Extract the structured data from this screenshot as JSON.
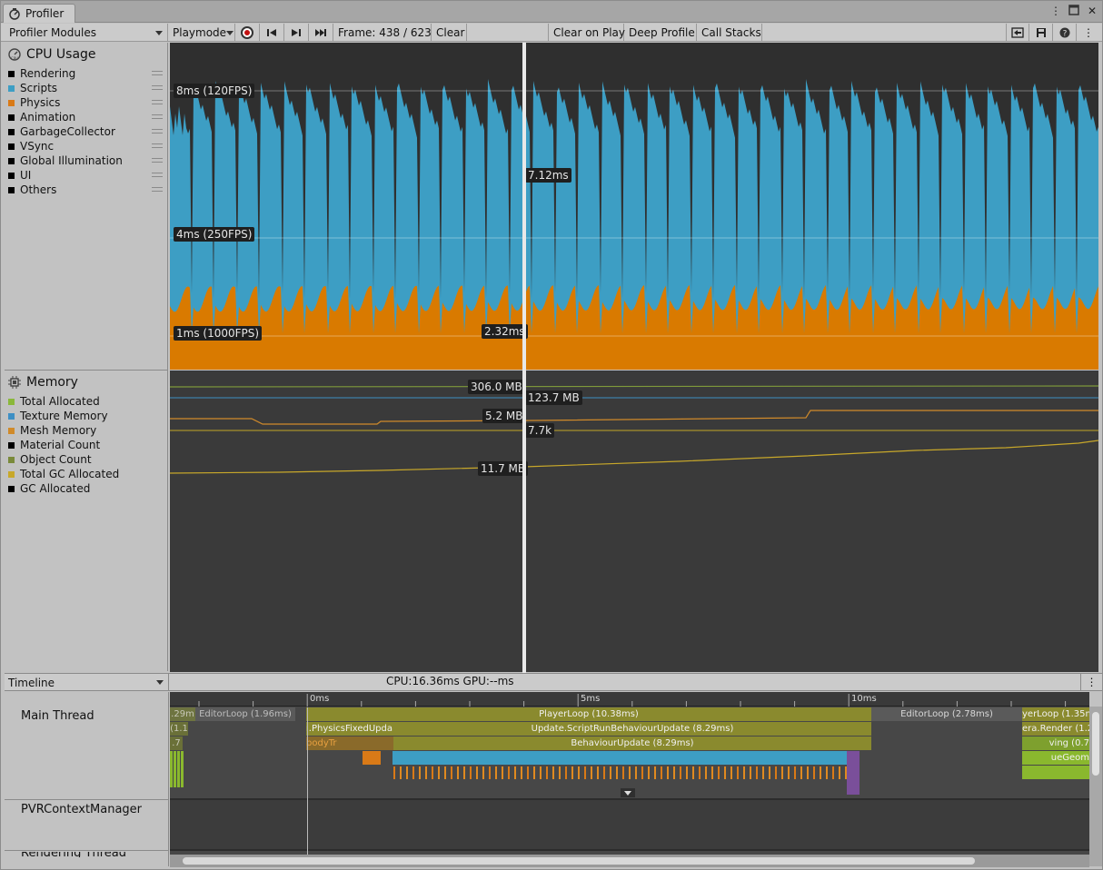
{
  "window": {
    "tab_title": "Profiler",
    "menu_icon": "kebab-icon",
    "max_icon": "maximize-icon",
    "close_label": "✕"
  },
  "toolbar": {
    "modules_label": "Profiler Modules",
    "target_label": "Playmode",
    "frame_label": "Frame: 438 / 623",
    "clear_label": "Clear",
    "clear_on_play_label": "Clear on Play",
    "deep_profile_label": "Deep Profile",
    "call_stacks_label": "Call Stacks"
  },
  "cpu_module": {
    "title": "CPU Usage",
    "legend": [
      {
        "label": "Rendering",
        "color": "#000000"
      },
      {
        "label": "Scripts",
        "color": "#3d9ec4"
      },
      {
        "label": "Physics",
        "color": "#d97a17"
      },
      {
        "label": "Animation",
        "color": "#000000"
      },
      {
        "label": "GarbageCollector",
        "color": "#000000"
      },
      {
        "label": "VSync",
        "color": "#000000"
      },
      {
        "label": "Global Illumination",
        "color": "#000000"
      },
      {
        "label": "UI",
        "color": "#000000"
      },
      {
        "label": "Others",
        "color": "#000000"
      }
    ],
    "labels": {
      "line_8ms": "8ms (120FPS)",
      "line_4ms": "4ms (250FPS)",
      "line_1ms": "1ms (1000FPS)",
      "scripts_value": "7.12ms",
      "physics_value": "2.32ms"
    }
  },
  "memory_module": {
    "title": "Memory",
    "legend": [
      {
        "label": "Total Allocated",
        "color": "#8ab83a"
      },
      {
        "label": "Texture Memory",
        "color": "#3d8fc4"
      },
      {
        "label": "Mesh Memory",
        "color": "#d08a2a"
      },
      {
        "label": "Material Count",
        "color": "#000000"
      },
      {
        "label": "Object Count",
        "color": "#7a8a3a"
      },
      {
        "label": "Total GC Allocated",
        "color": "#c8a82a"
      },
      {
        "label": "GC Allocated",
        "color": "#000000"
      }
    ],
    "labels": {
      "total_allocated": "306.0 MB",
      "texture_memory": "123.7 MB",
      "mesh_memory": "5.2 MB",
      "object_count": "7.7k",
      "total_gc": "11.7 MB"
    }
  },
  "timeline": {
    "mode_label": "Timeline",
    "cpu_gpu": "CPU:16.36ms   GPU:--ms",
    "threads": [
      "Main Thread",
      "PVRContextManager",
      "Rendering Thread"
    ],
    "ticks": [
      "0ms",
      "5ms",
      "10ms"
    ],
    "blocks": {
      "pre_left": ".29m",
      "editor_left": "EditorLoop (1.96ms)",
      "playerloop": "PlayerLoop (10.38ms)",
      "editor_right": "EditorLoop (2.78ms)",
      "playerloop_right": "yerLoop (1.35m",
      "physics_fixed": "ı.PhysicsFixedUpda",
      "script_run": "Update.ScriptRunBehaviourUpdate (8.29ms)",
      "camera_render": "era.Render (1.2",
      "body_tr": "bodyTr",
      "behaviour_update": "BehaviourUpdate (8.29ms)",
      "ving": "ving (0.7",
      "geom": "ueGeom",
      "left_small_1": "(1.1",
      "left_small_2": ".7"
    }
  }
}
